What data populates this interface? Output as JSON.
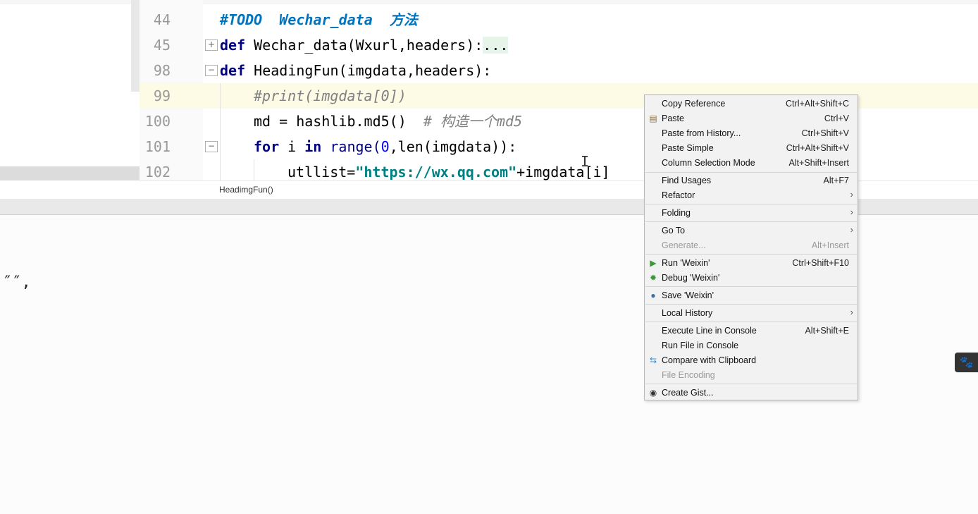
{
  "editor": {
    "lines": [
      {
        "num": "44",
        "code": "#TODO  Wechar_data  方法"
      },
      {
        "num": "45",
        "code_kw": "def",
        "code_rest": " Wechar_data(Wxurl,headers):",
        "code_dots": "..."
      },
      {
        "num": "98",
        "code_kw": "def",
        "code_rest": " HeadingFun(imgdata,headers):"
      },
      {
        "num": "99",
        "code": "#print(imgdata[0])"
      },
      {
        "num": "100",
        "code_a": "md = hashlib.md5()  ",
        "code_comment": "# 构造一个md5"
      },
      {
        "num": "101",
        "code_for": "for",
        "code_i": " i ",
        "code_in": "in",
        "code_range": " range(",
        "code_zero": "0",
        "code_rest": ",len(imgdata)):"
      },
      {
        "num": "102",
        "code_a": "utllist=",
        "code_str": "\"https://wx.qq.com\"",
        "code_rest": "+imgdata[i]"
      }
    ],
    "breadcrumb": "HeadimgFun()"
  },
  "lower": {
    "quote_text": "″″,"
  },
  "context_menu": {
    "items": [
      {
        "label": "Copy Reference",
        "shortcut": "Ctrl+Alt+Shift+C"
      },
      {
        "label": "Paste",
        "shortcut": "Ctrl+V",
        "icon": "paste-icon"
      },
      {
        "label": "Paste from History...",
        "shortcut": "Ctrl+Shift+V"
      },
      {
        "label": "Paste Simple",
        "shortcut": "Ctrl+Alt+Shift+V"
      },
      {
        "label": "Column Selection Mode",
        "shortcut": "Alt+Shift+Insert"
      },
      {
        "label": "Find Usages",
        "shortcut": "Alt+F7"
      },
      {
        "label": "Refactor",
        "submenu": true
      },
      {
        "label": "Folding",
        "submenu": true
      },
      {
        "label": "Go To",
        "submenu": true
      },
      {
        "label": "Generate...",
        "shortcut": "Alt+Insert",
        "disabled": true
      },
      {
        "label": "Run 'Weixin'",
        "shortcut": "Ctrl+Shift+F10",
        "icon": "run-icon"
      },
      {
        "label": "Debug 'Weixin'",
        "icon": "debug-icon"
      },
      {
        "label": "Save 'Weixin'",
        "icon": "python-icon"
      },
      {
        "label": "Local History",
        "submenu": true
      },
      {
        "label": "Execute Line in Console",
        "shortcut": "Alt+Shift+E"
      },
      {
        "label": "Run File in Console"
      },
      {
        "label": "Compare with Clipboard",
        "icon": "compare-icon"
      },
      {
        "label": "File Encoding",
        "disabled": true
      },
      {
        "label": "Create Gist...",
        "icon": "github-icon"
      }
    ]
  },
  "colors": {
    "keyword": "#000080",
    "comment": "#808080",
    "todo": "#0073bf",
    "string": "#008080",
    "highlight_line": "#fdfbe6",
    "menu_bg": "#f2f2f2"
  }
}
